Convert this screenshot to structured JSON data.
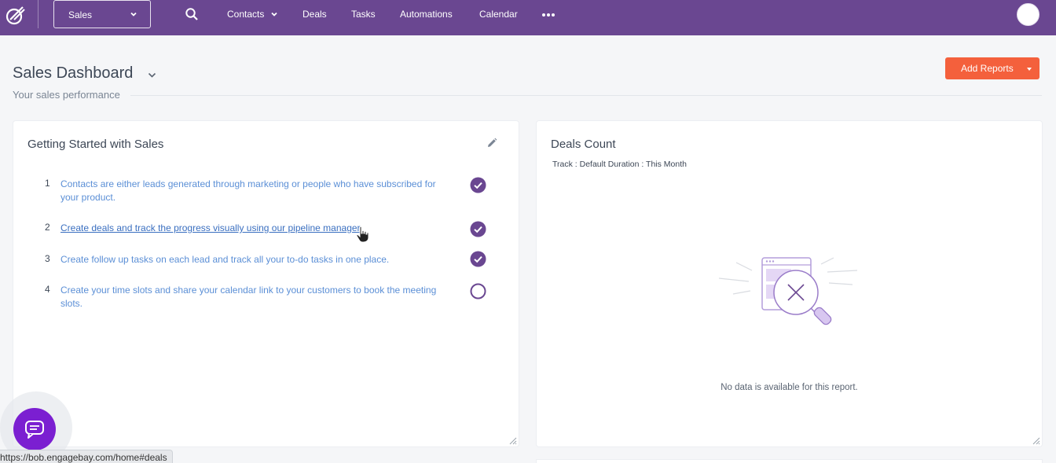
{
  "nav": {
    "module": "Sales",
    "items": {
      "contacts": "Contacts",
      "deals": "Deals",
      "tasks": "Tasks",
      "automations": "Automations",
      "calendar": "Calendar"
    },
    "icons": {
      "logo": "engagebay-logo-icon",
      "search": "search-icon",
      "more": "more-horizontal-icon",
      "avatar": "user-avatar"
    }
  },
  "header": {
    "title": "Sales Dashboard",
    "subtitle": "Your sales performance",
    "add_reports": "Add Reports"
  },
  "getting_started": {
    "title": "Getting Started with Sales",
    "steps": [
      {
        "num": "1",
        "text": "Contacts are either leads generated through marketing or people who have subscribed for your product.",
        "done": true
      },
      {
        "num": "2",
        "text": "Create deals and track the progress visually using our pipeline manager",
        "done": true
      },
      {
        "num": "3",
        "text": "Create follow up tasks on each lead and track all your to-do tasks in one place.",
        "done": true
      },
      {
        "num": "4",
        "text": "Create your time slots and share your calendar link to your customers to book the meeting slots.",
        "done": false
      }
    ]
  },
  "deals_count": {
    "title": "Deals Count",
    "subtitle": "Track : Default Duration : This Month",
    "empty_text": "No data is available for this report."
  },
  "status_bar": {
    "url": "https://bob.engagebay.com/home#deals"
  },
  "colors": {
    "topbar": "#6a4791",
    "accent_orange": "#f4603c",
    "check_purple": "#6a4791",
    "chat_button": "#7b1fd1",
    "link_blue": "#5b8fd6"
  }
}
